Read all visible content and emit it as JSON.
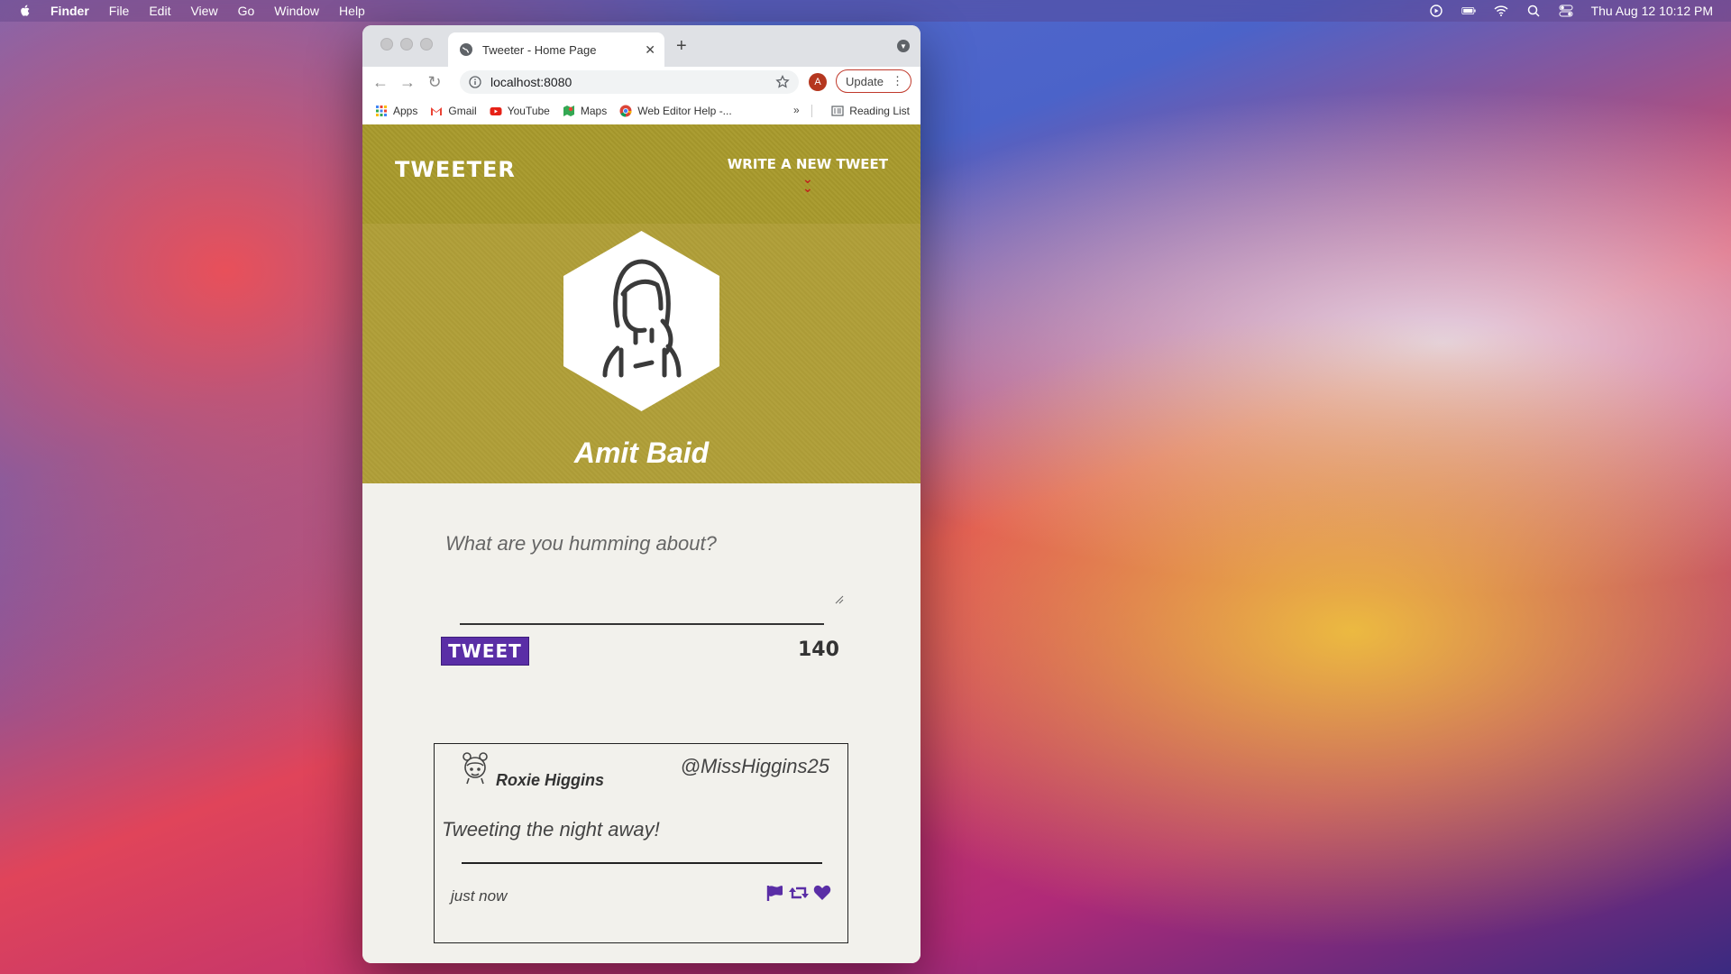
{
  "menubar": {
    "app_name": "Finder",
    "items": [
      "File",
      "Edit",
      "View",
      "Go",
      "Window",
      "Help"
    ],
    "clock": "Thu Aug 12  10:12 PM"
  },
  "browser": {
    "tab_title": "Tweeter - Home Page",
    "url": "localhost:8080",
    "profile_initial": "A",
    "update_label": "Update",
    "bookmarks": [
      "Apps",
      "Gmail",
      "YouTube",
      "Maps",
      "Web Editor Help -..."
    ],
    "more_bookmarks": "»",
    "reading_list": "Reading List"
  },
  "page": {
    "brand": "TWEETER",
    "write_new": "WRITE A NEW TWEET",
    "profile_name": "Amit Baid",
    "compose_placeholder": "What are you humming about?",
    "tweet_button": "TWEET",
    "char_counter": "140",
    "tweet": {
      "name": "Roxie Higgins",
      "handle": "@MissHiggins25",
      "content": "Tweeting the night away!",
      "time": "just now"
    }
  },
  "colors": {
    "header_olive": "#a89a2c",
    "profile_olive": "#b09f38",
    "accent_purple": "#5a2ea6",
    "chevron_red": "#c0261c"
  }
}
